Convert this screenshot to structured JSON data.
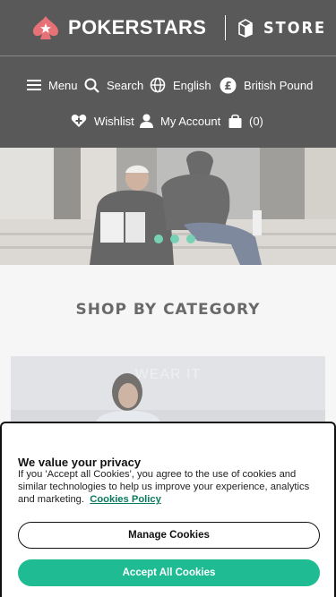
{
  "header": {
    "brand": "POKERSTARS",
    "store_label": "STORE",
    "menu_label": "Menu",
    "search_label": "Search",
    "language_label": "English",
    "currency_label": "British Pound",
    "wishlist_label": "Wishlist",
    "account_label": "My Account",
    "cart_count": "(0)"
  },
  "hero": {
    "slide_count": 3,
    "accent_color": "#2fb88e"
  },
  "main": {
    "section_title": "SHOP BY CATEGORY",
    "category_label": "WEAR IT"
  },
  "cookie_banner": {
    "title": "We value your privacy",
    "body": "If you 'Accept all Cookies', you agree to the use of cookies and similar technologies to help us improve your experience, analytics and marketing.",
    "policy_link": "Cookies Policy",
    "manage_button": "Manage Cookies",
    "accept_button": "Accept All Cookies",
    "accept_color": "#1fbc94",
    "link_color": "#0a7a5c"
  },
  "icons": [
    "spade-logo-icon",
    "store-bag-icon",
    "menu-icon",
    "search-icon",
    "globe-icon",
    "pound-icon",
    "wishlist-heart-icon",
    "account-icon",
    "cart-icon"
  ]
}
